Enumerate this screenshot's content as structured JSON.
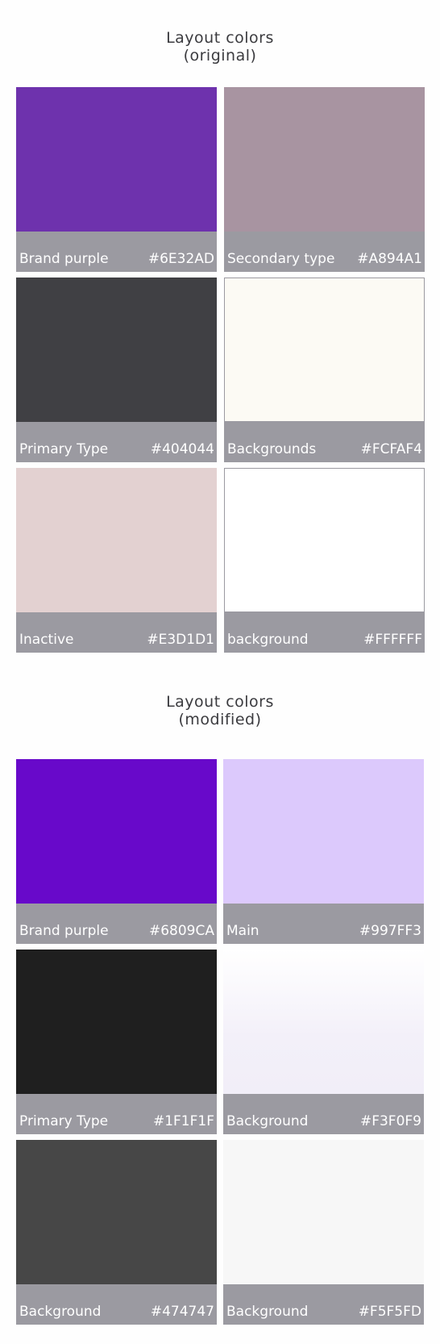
{
  "sections": [
    {
      "title_line1": "Layout colors",
      "title_line2": "(original)",
      "swatches": [
        {
          "name": "Brand purple",
          "hex": "#6E32AD",
          "color": "#6E32AD"
        },
        {
          "name": "Secondary type",
          "hex": "#A894A1",
          "color": "#A894A1"
        },
        {
          "name": "Primary Type",
          "hex": "#404044",
          "color": "#404044"
        },
        {
          "name": "Backgrounds",
          "hex": "#FCFAF4",
          "color": "#FCFAF4"
        },
        {
          "name": "Inactive",
          "hex": "#E3D1D1",
          "color": "#E3D1D1"
        },
        {
          "name": "background",
          "hex": "#FFFFFF",
          "color": "#FFFFFF"
        }
      ]
    },
    {
      "title_line1": "Layout colors",
      "title_line2": "(modified)",
      "swatches": [
        {
          "name": "Brand purple",
          "hex": "#6809CA",
          "color": "#6809CA"
        },
        {
          "name": "Main",
          "hex": "#997FF3",
          "color": "#DCC9FC"
        },
        {
          "name": "Primary Type",
          "hex": "#1F1F1F",
          "color": "#1F1F1F"
        },
        {
          "name": "Background",
          "hex": "#F3F0F9",
          "color": "#F3F0F9"
        },
        {
          "name": "Background",
          "hex": "#474747",
          "color": "#474747"
        },
        {
          "name": "Background",
          "hex": "#F5F5FD",
          "color": "#F7F7F7"
        }
      ]
    }
  ]
}
